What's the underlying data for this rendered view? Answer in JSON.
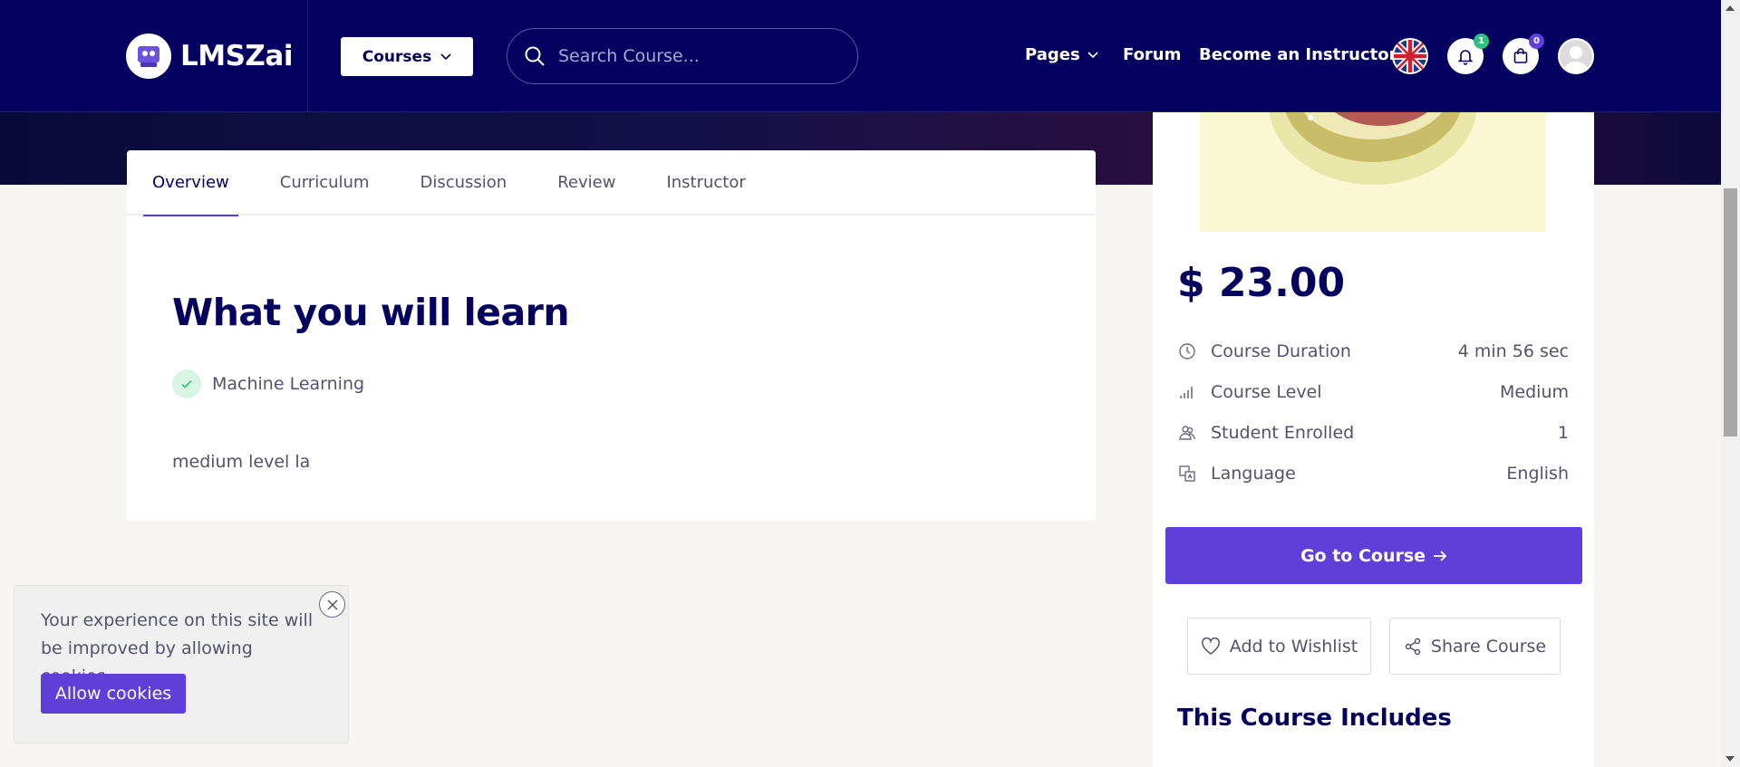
{
  "header": {
    "logo_text": "LMSZai",
    "courses_label": "Courses",
    "search_placeholder": "Search Course...",
    "nav_pages": "Pages",
    "nav_forum": "Forum",
    "nav_instructor": "Become an Instructor",
    "notifications_count": "1",
    "cart_count": "0",
    "colors": {
      "bg": "#030060",
      "notif_badge": "#2ec27e",
      "cart_badge": "#5e3fd9"
    }
  },
  "tabs": [
    {
      "label": "Overview",
      "active": true
    },
    {
      "label": "Curriculum",
      "active": false
    },
    {
      "label": "Discussion",
      "active": false
    },
    {
      "label": "Review",
      "active": false
    },
    {
      "label": "Instructor",
      "active": false
    }
  ],
  "overview": {
    "title": "What you will learn",
    "items": [
      "Machine Learning"
    ],
    "description": "medium level la"
  },
  "sidebar": {
    "price": "$ 23.00",
    "info": [
      {
        "icon": "clock-icon",
        "label": "Course Duration",
        "value": "4 min 56 sec"
      },
      {
        "icon": "signal-bars-icon",
        "label": "Course Level",
        "value": "Medium"
      },
      {
        "icon": "students-icon",
        "label": "Student Enrolled",
        "value": "1"
      },
      {
        "icon": "translate-icon",
        "label": "Language",
        "value": "English"
      }
    ],
    "go_button": "Go to Course",
    "wishlist_button": "Add to Wishlist",
    "share_button": "Share Course",
    "includes_title": "This Course Includes",
    "accent": "#5e3fd9"
  },
  "cookie": {
    "text": "Your experience on this site will be improved by allowing cookies",
    "button": "Allow cookies"
  }
}
